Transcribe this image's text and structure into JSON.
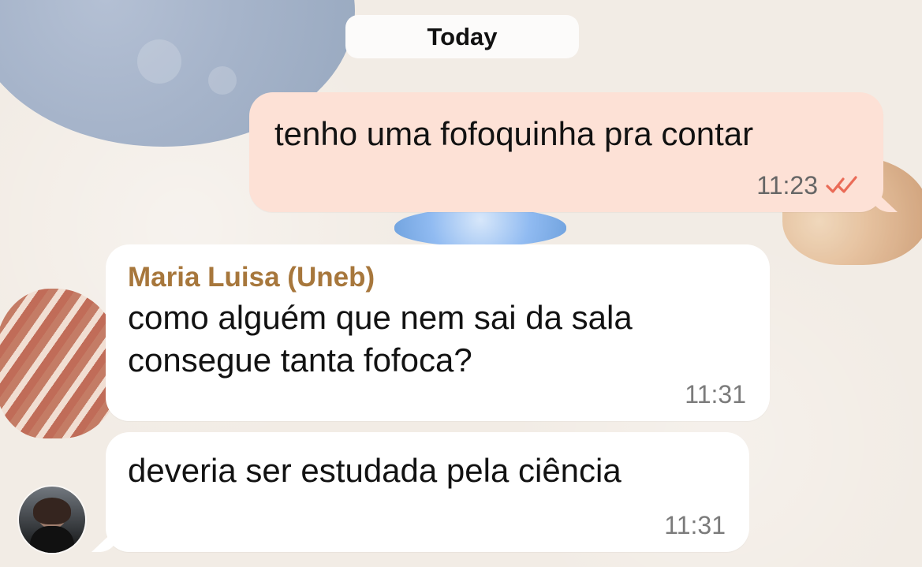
{
  "chat": {
    "date_label": "Today",
    "messages": [
      {
        "text": "tenho uma fofoquinha pra contar",
        "time": "11:23",
        "status_icon": "double-check-icon"
      },
      {
        "sender": "Maria Luisa (Uneb)",
        "text": "como alguém que nem sai da sala\nconsegue tanta fofoca?",
        "time": "11:31"
      },
      {
        "text": "deveria ser estudada pela ciência",
        "time": "11:31"
      }
    ]
  },
  "colors": {
    "outgoing_bubble": "#fde1d6",
    "incoming_bubble": "#ffffff",
    "sender_name": "#a7773c",
    "read_receipt": "#ea6b57",
    "wallpaper": "#f2ece5"
  },
  "icons": {
    "read_receipt": "double-check-icon",
    "avatar": "avatar"
  }
}
